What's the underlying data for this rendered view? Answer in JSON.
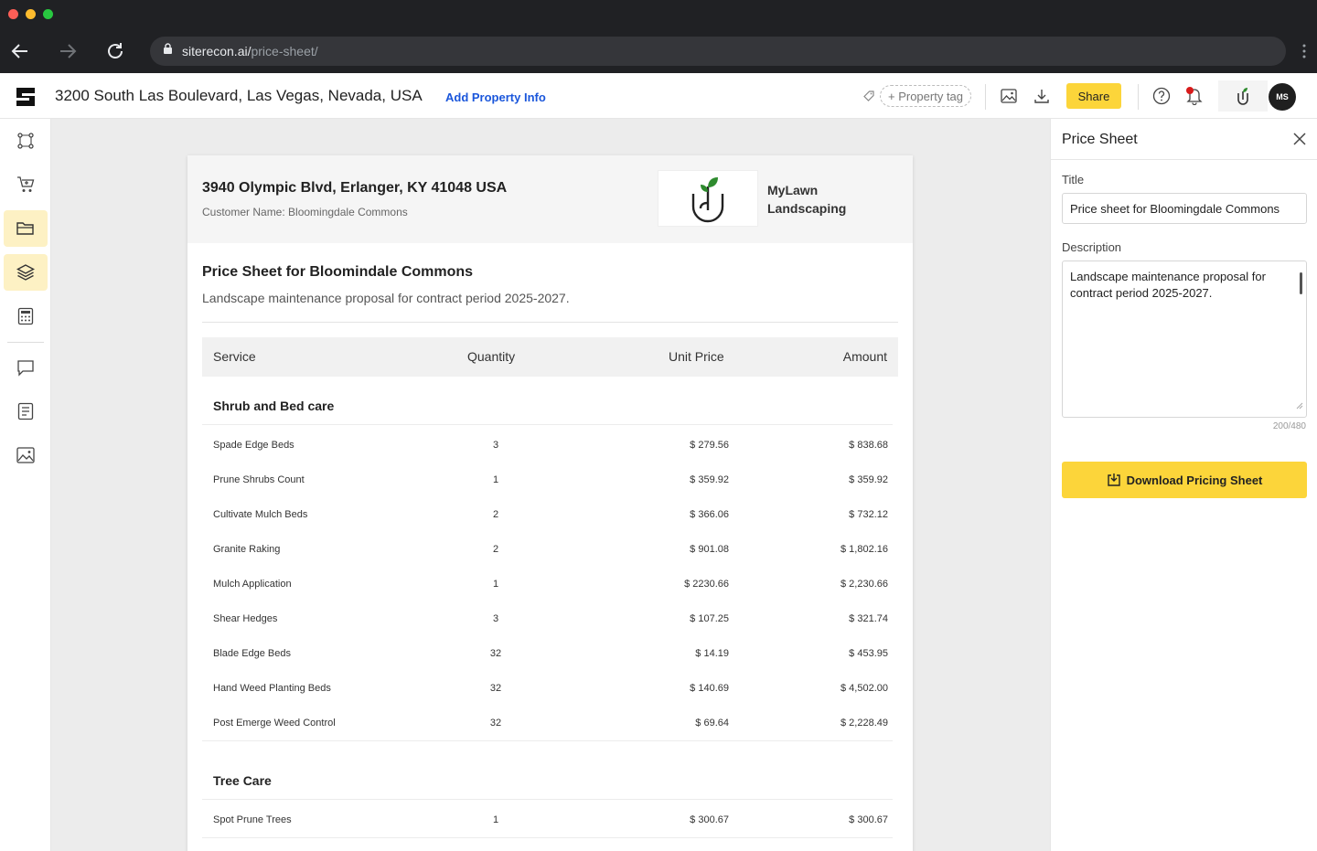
{
  "browser": {
    "url_host": "siterecon.ai/",
    "url_path": "price-sheet/"
  },
  "header": {
    "property_title": "3200 South Las Boulevard, Las Vegas, Nevada, USA",
    "add_property_info": "Add Property Info",
    "property_tag": "+ Property tag",
    "share_label": "Share",
    "avatar_initials": "MS"
  },
  "rail": {
    "items": [
      "route-icon",
      "cart-icon",
      "folder-icon",
      "layers-icon",
      "calculator-icon",
      "chat-icon",
      "document-icon",
      "image-icon"
    ],
    "active": [
      "folder-icon",
      "layers-icon"
    ]
  },
  "sheet": {
    "address": "3940 Olympic Blvd,  Erlanger, KY 41048 USA",
    "customer": "Customer Name: Bloomingdale Commons",
    "company_name": "MyLawn Landscaping",
    "title": "Price Sheet for Bloomindale Commons",
    "description": "Landscape maintenance proposal for contract period 2025-2027.",
    "columns": {
      "service": "Service",
      "quantity": "Quantity",
      "unit_price": "Unit Price",
      "amount": "Amount"
    },
    "sections": [
      {
        "name": "Shrub and Bed care",
        "rows": [
          {
            "service": "Spade Edge Beds",
            "quantity": "3",
            "unit_price": "$ 279.56",
            "amount": "$ 838.68"
          },
          {
            "service": "Prune Shrubs Count",
            "quantity": "1",
            "unit_price": "$ 359.92",
            "amount": "$ 359.92"
          },
          {
            "service": "Cultivate Mulch Beds",
            "quantity": "2",
            "unit_price": "$ 366.06",
            "amount": "$ 732.12"
          },
          {
            "service": "Granite Raking",
            "quantity": "2",
            "unit_price": "$ 901.08",
            "amount": "$ 1,802.16"
          },
          {
            "service": "Mulch Application",
            "quantity": "1",
            "unit_price": "$ 2230.66",
            "amount": "$ 2,230.66"
          },
          {
            "service": "Shear Hedges",
            "quantity": "3",
            "unit_price": "$ 107.25",
            "amount": "$ 321.74"
          },
          {
            "service": "Blade Edge Beds",
            "quantity": "32",
            "unit_price": "$ 14.19",
            "amount": "$ 453.95"
          },
          {
            "service": "Hand Weed Planting Beds",
            "quantity": "32",
            "unit_price": "$ 140.69",
            "amount": "$ 4,502.00"
          },
          {
            "service": "Post Emerge Weed Control",
            "quantity": "32",
            "unit_price": "$ 69.64",
            "amount": "$ 2,228.49"
          }
        ]
      },
      {
        "name": "Tree Care",
        "rows": [
          {
            "service": "Spot Prune Trees",
            "quantity": "1",
            "unit_price": "$ 300.67",
            "amount": "$ 300.67"
          }
        ]
      }
    ]
  },
  "panel": {
    "title": "Price Sheet",
    "title_label": "Title",
    "title_value": "Price sheet for Bloomingdale Commons",
    "description_label": "Description",
    "description_value": "Landscape maintenance proposal for contract period 2025-2027.",
    "counter": "200/480",
    "download_label": "Download Pricing Sheet"
  },
  "colors": {
    "accent_yellow": "#fcd53a",
    "active_rail": "#fdf1c4",
    "link_blue": "#1a56db",
    "logo_green": "#2e8b2e"
  }
}
